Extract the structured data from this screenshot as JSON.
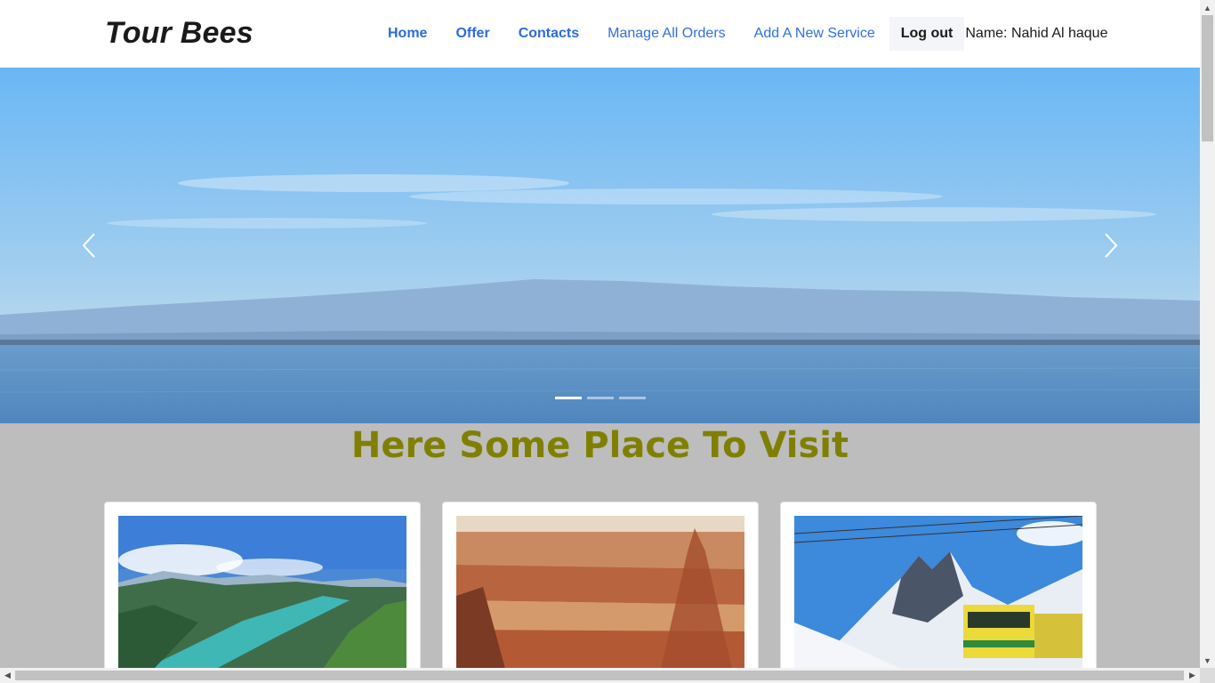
{
  "header": {
    "brand": "Tour Bees",
    "nav": [
      {
        "label": "Home"
      },
      {
        "label": "Offer"
      },
      {
        "label": "Contacts"
      },
      {
        "label": "Manage All Orders"
      },
      {
        "label": "Add A New Service"
      }
    ],
    "logout_label": "Log out",
    "user_name": "Name: Nahid Al haque"
  },
  "carousel": {
    "slide_count": 3,
    "active_index": 0,
    "prev_icon": "chevron-left-icon",
    "next_icon": "chevron-right-icon"
  },
  "section": {
    "title": "Here Some Place To Visit"
  },
  "places": [
    {
      "image": "alpine-lake-landscape"
    },
    {
      "image": "red-canyon-landscape"
    },
    {
      "image": "snowy-mountain-train"
    }
  ],
  "colors": {
    "nav_link": "#2f6fe0",
    "section_title": "#808000",
    "page_bg": "#bdbdbd"
  }
}
